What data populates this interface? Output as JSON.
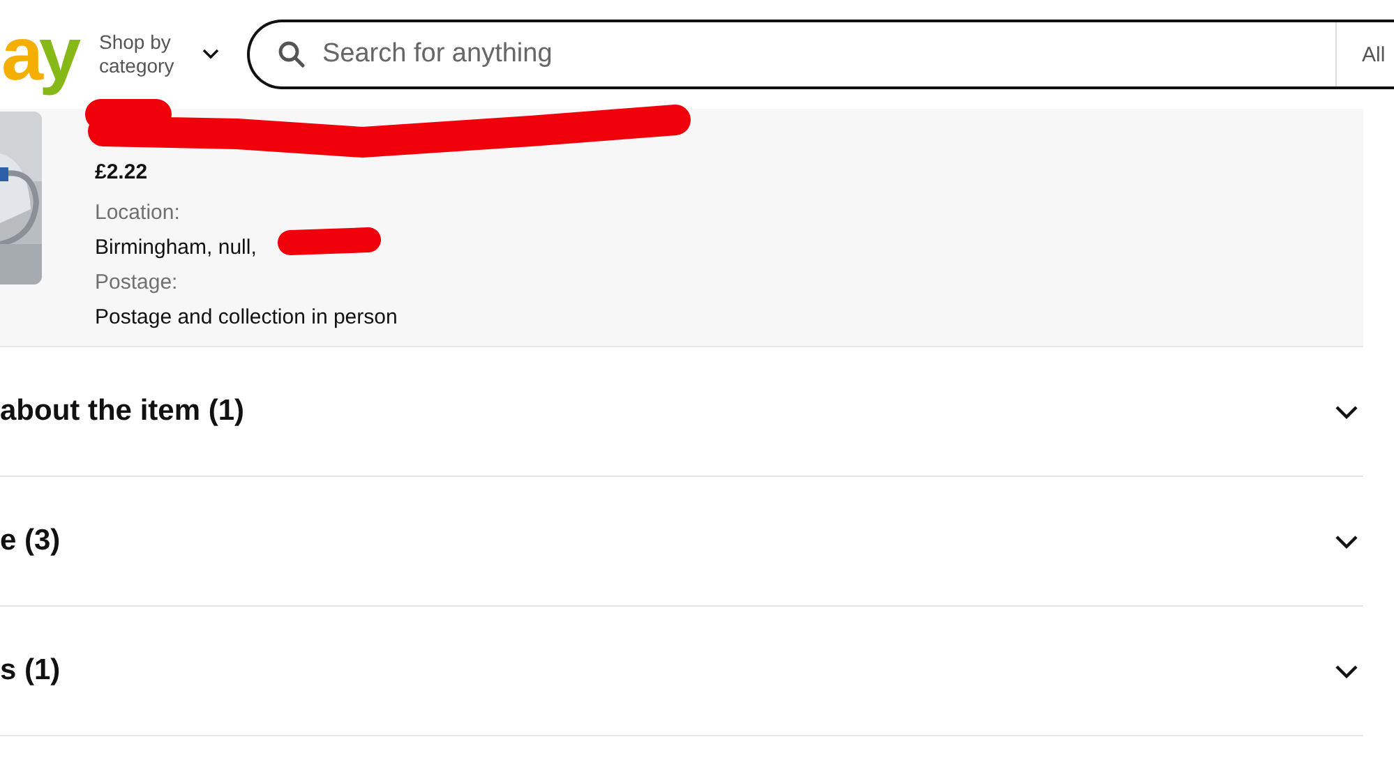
{
  "header": {
    "logo": [
      {
        "char": "a",
        "color": "#f5af02"
      },
      {
        "char": "y",
        "color": "#86b817"
      }
    ],
    "shop_by_category": "Shop by category",
    "search": {
      "placeholder": "Search for anything"
    },
    "category_select": "All"
  },
  "item": {
    "price": "£2.22",
    "fields": [
      {
        "label": "Location:",
        "value": "Birmingham, null,"
      },
      {
        "label": "Postage:",
        "value": "Postage and collection in person"
      }
    ]
  },
  "sections": [
    {
      "title": "about the item (1)",
      "expanded": false
    },
    {
      "title": "e (3)",
      "expanded": false
    },
    {
      "title": "s (1)",
      "expanded": false
    }
  ]
}
